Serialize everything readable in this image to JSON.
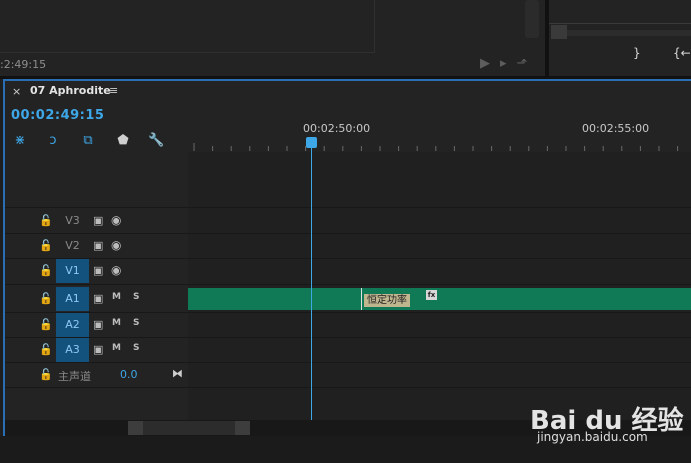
{
  "top_panel": {
    "timecode": ":2:49:15",
    "right_icons": [
      "}",
      "{←"
    ]
  },
  "sequence": {
    "close_glyph": "×",
    "title": "07 Aphrodite",
    "menu_glyph": "≡",
    "timecode": "00:02:49:15"
  },
  "ruler": {
    "labels": [
      "00:02:50:00",
      "00:02:55:00"
    ]
  },
  "tracks": [
    {
      "name": "V3",
      "type": "video",
      "targeted": false
    },
    {
      "name": "V2",
      "type": "video",
      "targeted": false
    },
    {
      "name": "V1",
      "type": "video",
      "targeted": true
    },
    {
      "name": "A1",
      "type": "audio",
      "targeted": true
    },
    {
      "name": "A2",
      "type": "audio",
      "targeted": true
    },
    {
      "name": "A3",
      "type": "audio",
      "targeted": true
    }
  ],
  "audio_buttons": {
    "mute": "M",
    "solo": "S"
  },
  "master": {
    "label": "主声道",
    "volume": "0.0"
  },
  "clip": {
    "transition_label": "恒定功率",
    "fx_badge": "fx"
  },
  "watermark": {
    "logo": "Bai du 经验",
    "url": "jingyan.baidu.com"
  },
  "colors": {
    "accent": "#3ea7e8",
    "clip": "#0f7a55",
    "target": "#14527e"
  }
}
